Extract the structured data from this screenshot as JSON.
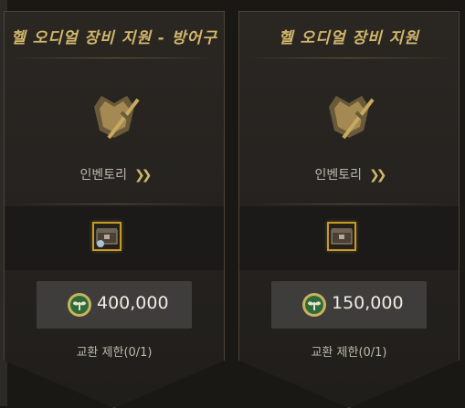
{
  "cards": [
    {
      "title": "헬 오디얼 장비 지원 - 방어구",
      "inventory_label": "인벤토리",
      "price": "400,000",
      "exchange_limit": "교환 제한(0/1)",
      "item_icon": "armor-chest-icon"
    },
    {
      "title": "헬 오디얼 장비 지원",
      "inventory_label": "인벤토리",
      "price": "150,000",
      "exchange_limit": "교환 제한(0/1)",
      "item_icon": "equipment-chest-icon"
    }
  ],
  "colors": {
    "title_gold": "#d2b66a",
    "item_border": "#c69a27",
    "coin_green": "#2f6b3a",
    "price_bg": "#3e3d3b"
  },
  "icons": {
    "inventory": "armor-sword-icon",
    "currency": "leaf-coin-icon",
    "chevron": "double-chevron-right-icon"
  }
}
